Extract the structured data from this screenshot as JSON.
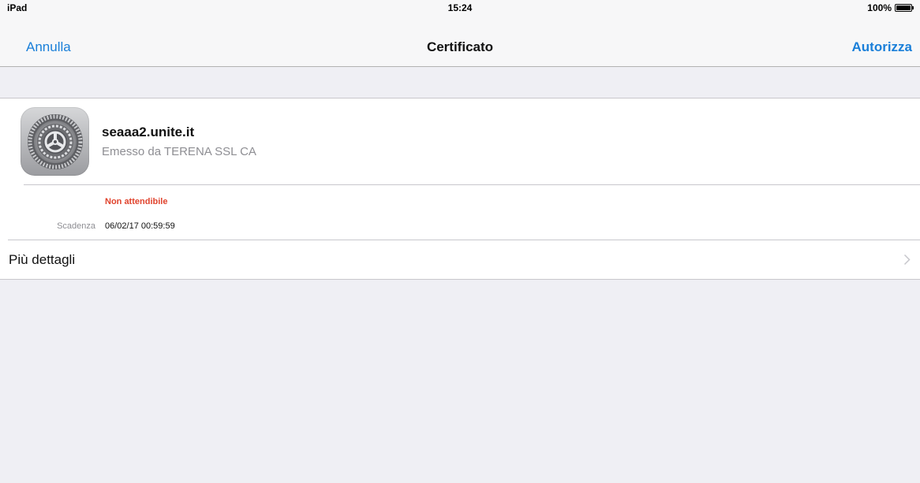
{
  "status_bar": {
    "device": "iPad",
    "time": "15:24",
    "battery": "100%",
    "battery_icon": "battery-full-icon"
  },
  "nav": {
    "cancel_label": "Annulla",
    "title": "Certificato",
    "authorize_label": "Autorizza"
  },
  "certificate": {
    "icon": "settings-gear-icon",
    "name": "seaaa2.unite.it",
    "issuer": "Emesso da TERENA SSL CA",
    "trust_status": "Non attendibile",
    "expiry_label": "Scadenza",
    "expiry_value": "06/02/17 00:59:59"
  },
  "more_details": {
    "label": "Più dettagli",
    "icon": "chevron-right-icon"
  },
  "colors": {
    "accent": "#1a7fd9",
    "warning": "#e0432d",
    "background": "#efeff4"
  }
}
